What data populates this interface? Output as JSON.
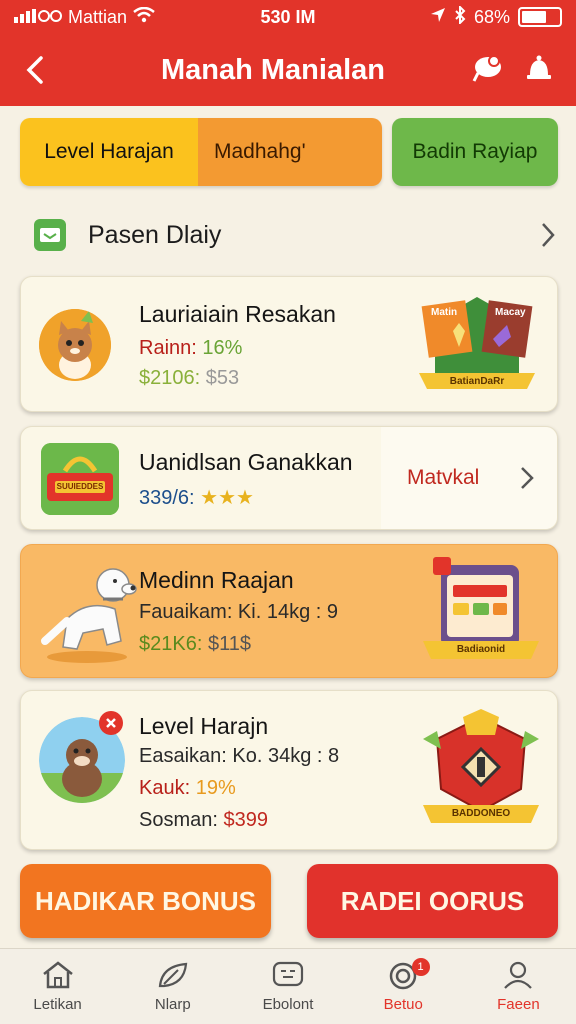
{
  "status": {
    "carrier": "Mattian",
    "time": "530 IM",
    "battery": "68%",
    "battery_level": 0.68
  },
  "header": {
    "title": "Manah Manialan"
  },
  "tabs": [
    {
      "label": "Level Harajan"
    },
    {
      "label": "Madhahg'"
    },
    {
      "label": "Badin Rayiap"
    }
  ],
  "section": {
    "label": "Pasen Dlaiy"
  },
  "cards": [
    {
      "name": "Lauriaiain Resakan",
      "line1_label": "Rainn:",
      "line1_value": "16%",
      "line2_value": "$2106:",
      "line2_old": "$53",
      "badge_text": "Macay",
      "badge_text_2": "Matin",
      "ribbon": "BatianDaRr"
    },
    {
      "name": "Uanidlsan Ganakkan",
      "line1": "339/6:",
      "stars": "★★★",
      "badge_text": "SUUIEDDES",
      "action": "Matvkal"
    },
    {
      "name": "Medinn Raajan",
      "line1": "Fauaikam: Ki. 14kg : 9",
      "line2_value": "$21K6:",
      "line2_old": "$11$",
      "ribbon": "Badiaonid"
    },
    {
      "name": "Level Harajn",
      "line1": "Easaikan: Ko. 34kg : 8",
      "line2_label": "Kauk:",
      "line2_value": "19%",
      "line3_label": "Sosman:",
      "line3_value": "$399",
      "ribbon": "BADDONEO"
    }
  ],
  "actions": {
    "left": "HADIKAR BONUS",
    "right": "RADEI OORUS"
  },
  "nav": [
    {
      "label": "Letikan",
      "icon": "home-icon"
    },
    {
      "label": "Nlarp",
      "icon": "leaf-icon"
    },
    {
      "label": "Ebolont",
      "icon": "chat-icon"
    },
    {
      "label": "Betuo",
      "icon": "ring-icon",
      "badge": "1"
    },
    {
      "label": "Faeen",
      "icon": "profile-icon"
    }
  ],
  "colors": {
    "accent": "#e2342a",
    "yellow": "#fbc21e",
    "orange": "#f39a32",
    "green": "#6eb84a"
  }
}
